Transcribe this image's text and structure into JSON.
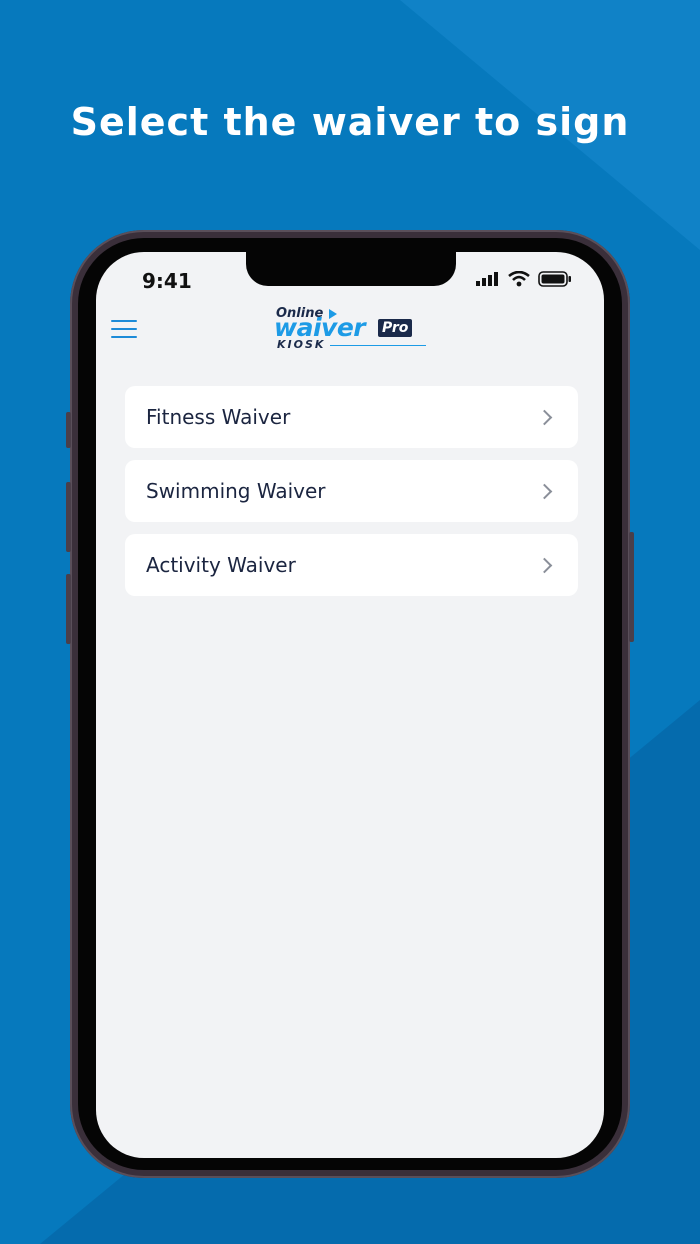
{
  "headline": "Select the waiver to sign",
  "status_bar": {
    "time": "9:41"
  },
  "logo": {
    "online": "Online",
    "waiver": "waiver",
    "pro": "Pro",
    "kiosk": "KIOSK"
  },
  "waivers": [
    {
      "label": "Fitness Waiver"
    },
    {
      "label": "Swimming Waiver"
    },
    {
      "label": "Activity Waiver"
    }
  ],
  "colors": {
    "background": "#0679bd",
    "accent": "#1d9be6",
    "screen": "#f2f3f5"
  },
  "icons": [
    "hamburger-menu-icon",
    "signal-icon",
    "wifi-icon",
    "battery-icon",
    "chevron-right-icon"
  ]
}
